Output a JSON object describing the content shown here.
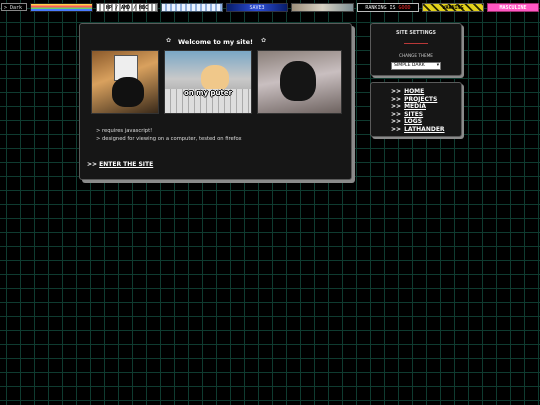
{
  "topbar": {
    "mode_toggle": "> Dark",
    "badges": [
      {
        "name": "rainbow-badge",
        "text": ""
      },
      {
        "name": "hp-badge",
        "text": "HP / AMD / HBC"
      },
      {
        "name": "pixel-badge",
        "text": ""
      },
      {
        "name": "blue-badge",
        "text": "SAVE3"
      },
      {
        "name": "photo-badge",
        "text": ""
      },
      {
        "name": "ranking-badge",
        "text": "RANKING IS",
        "text_red": "GOOD"
      },
      {
        "name": "hazard-badge",
        "text": "WARNING"
      },
      {
        "name": "pink-badge",
        "text": "MASCULINE"
      }
    ]
  },
  "main": {
    "title": "Welcome to my site!",
    "photo_caption": "on my puter",
    "notes": [
      "> requires javascript!",
      "> designed for viewing on a computer, tested on firefox"
    ],
    "enter_prefix": ">>",
    "enter_label": "ENTER THE SITE"
  },
  "settings": {
    "title": "SITE SETTINGS",
    "theme_label": "CHANGE THEME",
    "theme_value": "SIMPLE DARK"
  },
  "nav": {
    "prefix": ">>",
    "items": [
      "HOME",
      "PROJECTS",
      "MEDIA",
      "SITES",
      "LOGS",
      "LATHANDER"
    ]
  },
  "colors": {
    "background": "#000000",
    "grid": "#0f3b30",
    "panel": "#161616",
    "panel_shadow": "#8a8a8a",
    "accent_red": "#ff2a2a"
  }
}
